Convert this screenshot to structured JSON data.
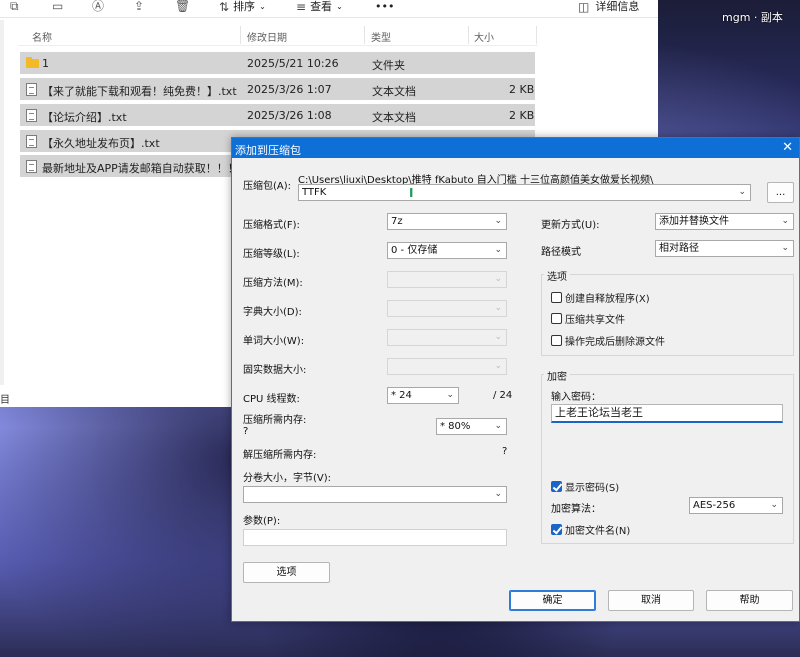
{
  "overlay_text": "mgm · 副本",
  "explorer": {
    "toolbar": {
      "sort_label": "排序",
      "view_label": "查看",
      "more_label": "•••",
      "details_label": "详细信息"
    },
    "columns": [
      "名称",
      "修改日期",
      "类型",
      "大小"
    ],
    "files": [
      {
        "name": "1",
        "date": "2025/5/21 10:26",
        "type": "文件夹",
        "size": "",
        "icon": "folder-icon"
      },
      {
        "name": "【来了就能下载和观看！纯免费！】.txt",
        "date": "2025/3/26 1:07",
        "type": "文本文档",
        "size": "2 KB",
        "icon": "text-file-icon"
      },
      {
        "name": "【论坛介绍】.txt",
        "date": "2025/3/26 1:08",
        "type": "文本文档",
        "size": "2 KB",
        "icon": "text-file-icon"
      },
      {
        "name": "【永久地址发布页】.txt",
        "date": "",
        "type": "",
        "size": "",
        "icon": "text-file-icon"
      },
      {
        "name": "最新地址及APP请发邮箱自动获取！！！...",
        "date": "",
        "type": "",
        "size": "",
        "icon": "text-file-icon"
      }
    ],
    "status_left": "目"
  },
  "dialog": {
    "title": "添加到压缩包",
    "close_glyph": "✕",
    "archive_label": "压缩包(A):",
    "archive_path": "C:\\Users\\liuxi\\Desktop\\推特 fKabuto 自入门槛 十三位高颜值美女做爱长视频\\",
    "archive_name": "TTFK",
    "browse_label": "...",
    "format_label": "压缩格式(F):",
    "format_value": "7z",
    "level_label": "压缩等级(L):",
    "level_value": "0 - 仅存储",
    "method_label": "压缩方法(M):",
    "dict_label": "字典大小(D):",
    "word_label": "单词大小(W):",
    "solid_label": "固实数据大小:",
    "cpu_label": "CPU 线程数:",
    "cpu_value": "* 24",
    "cpu_total": "/ 24",
    "mem_label": "压缩所需内存:",
    "mem_q": "?",
    "mem_value": "* 80%",
    "decomp_label": "解压缩所需内存:",
    "decomp_value": "?",
    "split_label": "分卷大小，字节(V):",
    "params_label": "参数(P):",
    "options_btn": "选项",
    "update_label": "更新方式(U):",
    "update_value": "添加并替换文件",
    "path_label": "路径模式",
    "path_value": "相对路径",
    "options_group": "选项",
    "opt_sfx": "创建自释放程序(X)",
    "opt_shared": "压缩共享文件",
    "opt_delete": "操作完成后删除源文件",
    "encrypt_group": "加密",
    "pw_label": "输入密码：",
    "pw_value": "上老王论坛当老王",
    "show_pw": "显示密码(S)",
    "enc_method_label": "加密算法：",
    "enc_method_value": "AES-256",
    "enc_names": "加密文件名(N)",
    "ok": "确定",
    "cancel": "取消",
    "help": "帮助"
  }
}
